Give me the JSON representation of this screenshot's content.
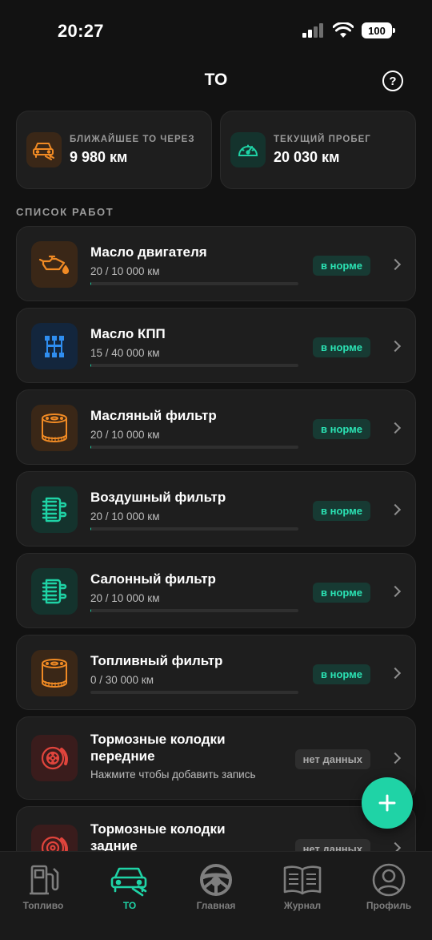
{
  "status_bar": {
    "time": "20:27",
    "battery": "100"
  },
  "header": {
    "title": "ТО",
    "help_icon": "?"
  },
  "summary": [
    {
      "caption": "БЛИЖАЙШЕЕ ТО ЧЕРЕЗ",
      "value": "9 980 км",
      "icon": "car-service-icon",
      "color": "#f08a24"
    },
    {
      "caption": "ТЕКУЩИЙ ПРОБЕГ",
      "value": "20 030 км",
      "icon": "speedometer-icon",
      "color": "#1fd3a6"
    }
  ],
  "section_title": "СПИСОК РАБОТ",
  "works": [
    {
      "name": "Масло двигателя",
      "sub": "20 / 10 000 км",
      "status": "в норме",
      "progress": 0.002,
      "icon": "engine-oil-icon"
    },
    {
      "name": "Масло КПП",
      "sub": "15 / 40 000 км",
      "status": "в норме",
      "progress": 0.0004,
      "icon": "gearbox-icon"
    },
    {
      "name": "Масляный фильтр",
      "sub": "20 / 10 000 км",
      "status": "в норме",
      "progress": 0.002,
      "icon": "oil-filter-icon"
    },
    {
      "name": "Воздушный фильтр",
      "sub": "20 / 10 000 км",
      "status": "в норме",
      "progress": 0.002,
      "icon": "air-filter-icon"
    },
    {
      "name": "Салонный фильтр",
      "sub": "20 / 10 000 км",
      "status": "в норме",
      "progress": 0.002,
      "icon": "cabin-filter-icon"
    },
    {
      "name": "Топливный фильтр",
      "sub": "0 / 30 000 км",
      "status": "в норме",
      "progress": 0,
      "icon": "fuel-filter-icon"
    },
    {
      "name_line1": "Тормозные колодки",
      "name_line2": "передние",
      "sub": "Нажмите чтобы добавить запись",
      "status": "нет данных",
      "icon": "brake-disc-icon"
    },
    {
      "name_line1": "Тормозные колодки",
      "name_line2": "задние",
      "status": "нет данных",
      "icon": "brake-disc-icon"
    }
  ],
  "tabs": [
    {
      "label": "Топливо",
      "icon": "fuel-pump-icon"
    },
    {
      "label": "ТО",
      "icon": "car-service-icon",
      "active": true
    },
    {
      "label": "Главная",
      "icon": "steering-wheel-icon"
    },
    {
      "label": "Журнал",
      "icon": "book-icon"
    },
    {
      "label": "Профиль",
      "icon": "profile-icon"
    }
  ],
  "colors": {
    "accent": "#1fd3a6",
    "orange": "#f08a24",
    "blue": "#2f8ef0",
    "red": "#e0443c",
    "background": "#121212",
    "card": "#1e1e1e"
  }
}
